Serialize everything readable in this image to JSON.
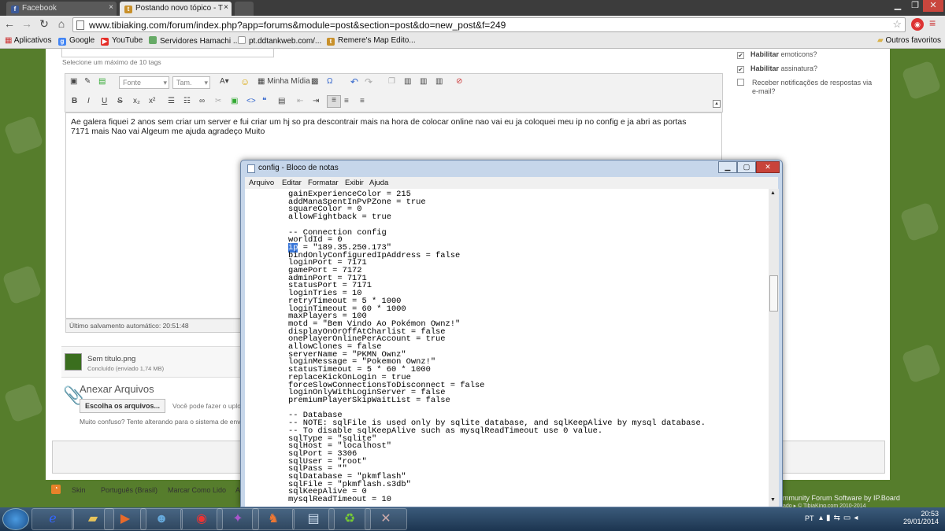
{
  "browser": {
    "tabs": [
      {
        "label": "Facebook"
      },
      {
        "label": "Postando novo tópico - T"
      }
    ],
    "url": "www.tibiaking.com/forum/index.php?app=forums&module=post&section=post&do=new_post&f=249",
    "bookmarks": [
      "Aplicativos",
      "Google",
      "YouTube",
      "Servidores Hamachi ...",
      "pt.ddtankweb.com/...",
      "Remere's Map Edito..."
    ],
    "other_bookmarks": "Outros favoritos"
  },
  "editor": {
    "tags_hint": "Selecione um máximo de 10 tags",
    "font_placeholder": "Fonte",
    "size_placeholder": "Tam.",
    "media_label": "Minha Mídia",
    "body_lines": [
      "Ae galera fiquei 2 anos sem criar um server e fui criar um hj so pra descontrair mais na hora de colocar online nao vai eu ja coloquei meu ip no config e ja abri as portas",
      "7171 mais Nao vai Algeum me ajuda agradeço Muito"
    ],
    "autosave": "Último salvamento automático: 20:51:48"
  },
  "options": [
    {
      "label": "Habilitar emoticons?",
      "checked": true
    },
    {
      "label": "Habilitar assinatura?",
      "checked": true
    },
    {
      "label": "Receber notificações de respostas via e-mail?",
      "checked": false
    }
  ],
  "attachment": {
    "name": "Sem título.png",
    "status": "Concluído (enviado 1,74 MB)"
  },
  "attach_section": {
    "title": "Anexar Arquivos",
    "button": "Escolha os arquivos...",
    "hint": "Você pode fazer o uplo",
    "confused": "Muito confuso? Tente alterando para o sistema de envio"
  },
  "footer": {
    "skin": "Skin",
    "language": "Português (Brasil)",
    "mark_read": "Marcar Como Lido",
    "letter": "A",
    "powered": "mmunity Forum Software by IP.Board",
    "copyright": "ado ▸ © TibiaKing.com 2010-2014"
  },
  "notepad": {
    "title": "config - Bloco de notas",
    "menu": [
      "Arquivo",
      "Editar",
      "Formatar",
      "Exibir",
      "Ajuda"
    ],
    "lines": [
      "gainExperienceColor = 215",
      "addManaSpentInPvPZone = true",
      "squareColor = 0",
      "allowFightback = true",
      "",
      "-- Connection config",
      "worldId = 0",
      "ip = \"189.35.250.173\"",
      "bindOnlyConfiguredIpAddress = false",
      "loginPort = 7171",
      "gamePort = 7172",
      "adminPort = 7171",
      "statusPort = 7171",
      "loginTries = 10",
      "retryTimeout = 5 * 1000",
      "loginTimeout = 60 * 1000",
      "maxPlayers = 100",
      "motd = \"Bem Vindo Ao Pokémon Ownz!\"",
      "displayOnOrOffAtCharlist = false",
      "onePlayerOnlinePerAccount = true",
      "allowClones = false",
      "serverName = \"PKMN Ownz\"",
      "loginMessage = \"Pokemon Ownz!\"",
      "statusTimeout = 5 * 60 * 1000",
      "replaceKickOnLogin = true",
      "forceSlowConnectionsToDisconnect = false",
      "loginOnlyWithLoginServer = false",
      "premiumPlayerSkipWaitList = false",
      "",
      "-- Database",
      "-- NOTE: sqlFile is used only by sqlite database, and sqlKeepAlive by mysql database.",
      "-- To disable sqlKeepAlive such as mysqlReadTimeout use 0 value.",
      "sqlType = \"sqlite\"",
      "sqlHost = \"localhost\"",
      "sqlPort = 3306",
      "sqlUser = \"root\"",
      "sqlPass = \"\"",
      "sqlDatabase = \"pkmflash\"",
      "sqlFile = \"pkmflash.s3db\"",
      "sqlKeepAlive = 0",
      "mysqlReadTimeout = 10"
    ]
  },
  "taskbar": {
    "lang": "PT",
    "time": "20:53",
    "date": "29/01/2014"
  }
}
